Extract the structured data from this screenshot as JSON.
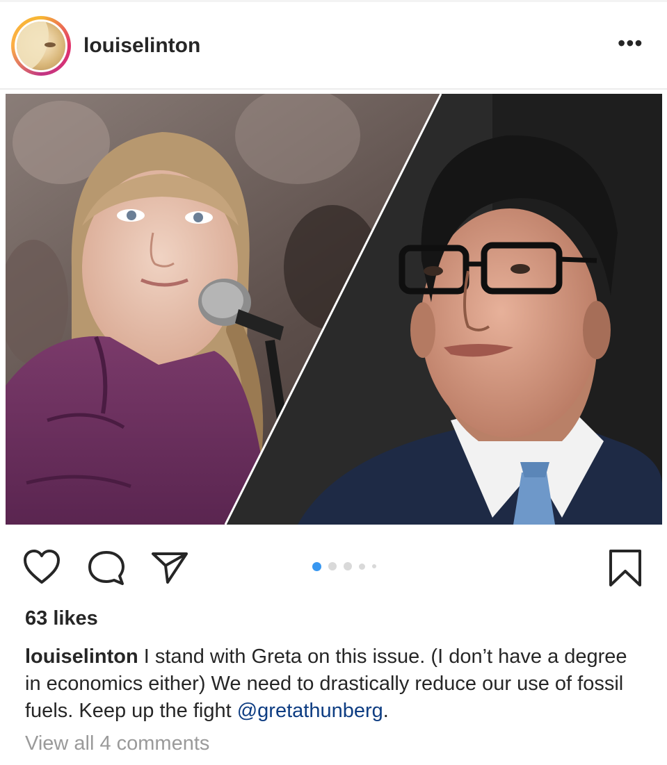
{
  "post": {
    "username": "louiselinton",
    "more_label": "•••",
    "likes": "63 likes",
    "caption": {
      "user": "louiselinton",
      "text": " I stand with Greta on this issue. (I don’t have a degree in economics either) We need to drastically reduce our use of fossil fuels. Keep up the fight ",
      "mention": "@gretathunberg",
      "end": "."
    },
    "view_comments": "View all 4 comments",
    "carousel": {
      "count": 5,
      "active_index": 0
    }
  },
  "icons": {
    "like": "heart-icon",
    "comment": "comment-bubble-icon",
    "share": "paper-plane-icon",
    "save": "bookmark-icon",
    "more": "more-options-icon"
  },
  "colors": {
    "text": "#262626",
    "muted": "#9a9a9a",
    "mention": "#0e3d82",
    "active_dot": "#3897f0"
  }
}
